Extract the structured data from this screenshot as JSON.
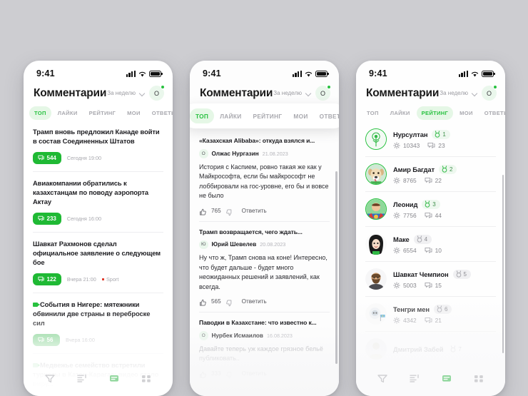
{
  "background_color": "#cdcdd1",
  "accent_color": "#27c13f",
  "badge_color": "#1fb934",
  "status_bar": {
    "time": "9:41",
    "signal_icon": "cellular-bars-icon",
    "wifi_icon": "wifi-icon",
    "battery_icon": "battery-full-icon"
  },
  "header": {
    "title": "Комментарии",
    "period_label": "За неделю",
    "chevron_icon": "chevron-down-icon",
    "avatar_letter": "О",
    "notification_dot": true
  },
  "tabs": [
    {
      "label": "ТОП"
    },
    {
      "label": "ЛАЙКИ"
    },
    {
      "label": "РЕЙТИНГ"
    },
    {
      "label": "МОИ"
    },
    {
      "label": "ОТВЕТЫ"
    }
  ],
  "bottom_nav": [
    {
      "icon": "filter-icon",
      "active": false
    },
    {
      "icon": "list-icon",
      "active": false
    },
    {
      "icon": "comments-icon",
      "active": true
    },
    {
      "icon": "grid-icon",
      "active": false
    }
  ],
  "screen_left": {
    "active_tab": "ТОП",
    "news": [
      {
        "title": "Трамп вновь предложил Канаде войти в состав Соединенных Штатов",
        "comments": "544",
        "time": "Сегодня 19:00",
        "category": "",
        "video": false
      },
      {
        "title": "Авиакомпании обратились к казахстанцам по поводу аэропорта Актау",
        "comments": "233",
        "time": "Сегодня 16:00",
        "category": "",
        "video": false
      },
      {
        "title": "Шавкат Рахмонов сделал официальное заявление о следующем бое",
        "comments": "122",
        "time": "Вчера 21:00",
        "category": "Sport",
        "video": false
      },
      {
        "title": "События в Нигере: мятежники обвинили две страны в переброске сил",
        "comments": "56",
        "time": "Вчера 16:00",
        "category": "",
        "video": true
      },
      {
        "title": "Медвежье семейство встретили туристы в Катон-Карагае: видео стало виру...",
        "comments": "",
        "time": "",
        "category": "",
        "video": true
      }
    ]
  },
  "screen_center": {
    "active_tab": "ТОП",
    "comments": [
      {
        "source": "«Казахская Alibaba»: откуда взялся и...",
        "avatar_letter": "О",
        "author": "Олжас Нургазин",
        "date": "21.08.2023",
        "text": "История с Каспием, ровно такая же как у Майкрософта, если бы майкрософт не лоббировали на гос-уровне, его бы и вовсе не было",
        "likes": "765",
        "reply_label": "Ответить",
        "like_icon": "thumbs-up-icon",
        "dislike_icon": "thumbs-down-icon"
      },
      {
        "source": "Трамп возвращается, чего ждать...",
        "avatar_letter": "Ю",
        "author": "Юрий Шевелев",
        "date": "20.08.2023",
        "text": "Ну что ж, Трамп снова на коне! Интересно, что будет дальше - будет много неожиданных решений и заявлений, как всегда.",
        "likes": "565",
        "reply_label": "Ответить",
        "like_icon": "thumbs-up-icon",
        "dislike_icon": "thumbs-down-icon"
      },
      {
        "source": "Паводки в Казахстане: что известно к...",
        "avatar_letter": "О",
        "author": "Нурбек Исмаилов",
        "date": "16.08.2023",
        "text": "Давайте теперь уж каждое грязное бельё публиковать..",
        "likes": "333",
        "reply_label": "Ответить",
        "like_icon": "thumbs-up-icon",
        "dislike_icon": "thumbs-down-icon"
      }
    ]
  },
  "screen_right": {
    "active_tab": "РЕЙТИНГ",
    "medal_icon": "medal-icon",
    "karma_icon": "karma-sun-icon",
    "comments_icon": "comment-bubble-icon",
    "users": [
      {
        "name": "Нурсултан",
        "rank": "1",
        "karma": "10343",
        "comments": "23",
        "avatar": "dandelion-avatar",
        "ring": true,
        "medal_green": true
      },
      {
        "name": "Амир Багдат",
        "rank": "2",
        "karma": "8765",
        "comments": "22",
        "avatar": "dog-avatar",
        "ring": true,
        "medal_green": true
      },
      {
        "name": "Леонид",
        "rank": "3",
        "karma": "7756",
        "comments": "44",
        "avatar": "superhero-avatar",
        "ring": true,
        "medal_green": true
      },
      {
        "name": "Маке",
        "rank": "4",
        "karma": "6554",
        "comments": "10",
        "avatar": "woman-avatar",
        "ring": false,
        "medal_green": false
      },
      {
        "name": "Шавкат Чемпион",
        "rank": "5",
        "karma": "5003",
        "comments": "15",
        "avatar": "bearded-man-avatar",
        "ring": false,
        "medal_green": false
      },
      {
        "name": "Тенгри мен",
        "rank": "6",
        "karma": "4342",
        "comments": "21",
        "avatar": "astronaut-avatar",
        "ring": false,
        "medal_green": false
      },
      {
        "name": "Дмитрий Забей",
        "rank": "7",
        "karma": "",
        "comments": "",
        "avatar": "plain-avatar",
        "ring": false,
        "medal_green": false
      }
    ]
  }
}
